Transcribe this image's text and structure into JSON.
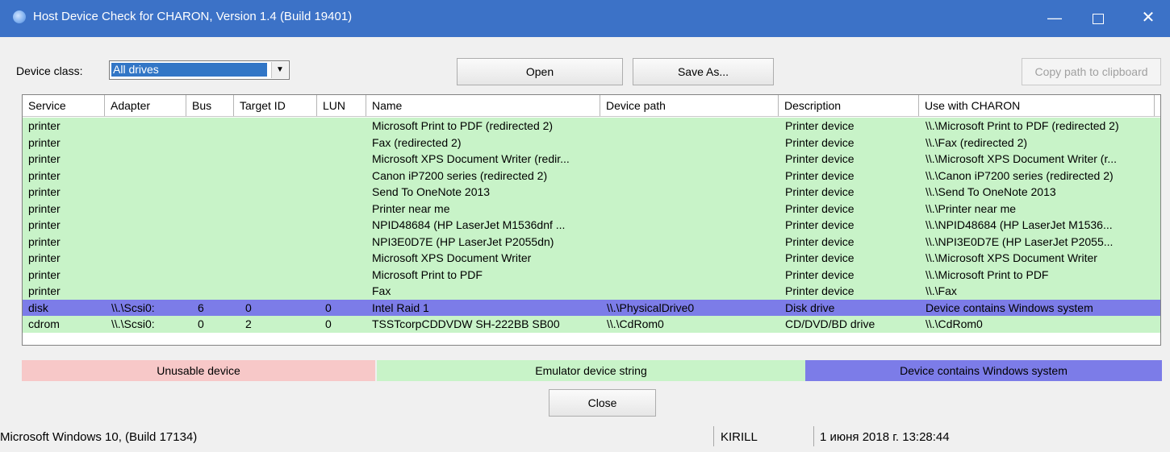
{
  "window": {
    "title": "Host Device Check for CHARON, Version 1.4 (Build 19401)",
    "controls": {
      "minimize": "—",
      "close": "✕"
    }
  },
  "toolbar": {
    "device_class_label": "Device class:",
    "device_class_value": "All drives",
    "open_label": "Open",
    "save_as_label": "Save As...",
    "copy_path_label": "Copy path to clipboard"
  },
  "table": {
    "columns": [
      "Service",
      "Adapter",
      "Bus",
      "Target ID",
      "LUN",
      "Name",
      "Device path",
      "Description",
      "Use with CHARON"
    ],
    "rows": [
      {
        "service": "printer",
        "adapter": "",
        "bus": "",
        "target": "",
        "lun": "",
        "name": "Microsoft Print to PDF (redirected 2)",
        "path": "",
        "description": "Printer device",
        "use": "\\\\.\\Microsoft Print to PDF (redirected 2)",
        "status": "emulator"
      },
      {
        "service": "printer",
        "adapter": "",
        "bus": "",
        "target": "",
        "lun": "",
        "name": "Fax (redirected 2)",
        "path": "",
        "description": "Printer device",
        "use": "\\\\.\\Fax (redirected 2)",
        "status": "emulator"
      },
      {
        "service": "printer",
        "adapter": "",
        "bus": "",
        "target": "",
        "lun": "",
        "name": "Microsoft XPS Document Writer (redir...",
        "path": "",
        "description": "Printer device",
        "use": "\\\\.\\Microsoft XPS Document Writer (r...",
        "status": "emulator"
      },
      {
        "service": "printer",
        "adapter": "",
        "bus": "",
        "target": "",
        "lun": "",
        "name": "Canon iP7200 series (redirected 2)",
        "path": "",
        "description": "Printer device",
        "use": "\\\\.\\Canon iP7200 series (redirected 2)",
        "status": "emulator"
      },
      {
        "service": "printer",
        "adapter": "",
        "bus": "",
        "target": "",
        "lun": "",
        "name": "Send To OneNote 2013",
        "path": "",
        "description": "Printer device",
        "use": "\\\\.\\Send To OneNote 2013",
        "status": "emulator"
      },
      {
        "service": "printer",
        "adapter": "",
        "bus": "",
        "target": "",
        "lun": "",
        "name": "Printer near me",
        "path": "",
        "description": "Printer device",
        "use": "\\\\.\\Printer near me",
        "status": "emulator"
      },
      {
        "service": "printer",
        "adapter": "",
        "bus": "",
        "target": "",
        "lun": "",
        "name": "NPID48684 (HP LaserJet M1536dnf ...",
        "path": "",
        "description": "Printer device",
        "use": "\\\\.\\NPID48684 (HP LaserJet M1536...",
        "status": "emulator"
      },
      {
        "service": "printer",
        "adapter": "",
        "bus": "",
        "target": "",
        "lun": "",
        "name": "NPI3E0D7E (HP LaserJet P2055dn)",
        "path": "",
        "description": "Printer device",
        "use": "\\\\.\\NPI3E0D7E (HP LaserJet P2055...",
        "status": "emulator"
      },
      {
        "service": "printer",
        "adapter": "",
        "bus": "",
        "target": "",
        "lun": "",
        "name": "Microsoft XPS Document Writer",
        "path": "",
        "description": "Printer device",
        "use": "\\\\.\\Microsoft XPS Document Writer",
        "status": "emulator"
      },
      {
        "service": "printer",
        "adapter": "",
        "bus": "",
        "target": "",
        "lun": "",
        "name": "Microsoft Print to PDF",
        "path": "",
        "description": "Printer device",
        "use": "\\\\.\\Microsoft Print to PDF",
        "status": "emulator"
      },
      {
        "service": "printer",
        "adapter": "",
        "bus": "",
        "target": "",
        "lun": "",
        "name": "Fax",
        "path": "",
        "description": "Printer device",
        "use": "\\\\.\\Fax",
        "status": "emulator"
      },
      {
        "service": "disk",
        "adapter": "\\\\.\\Scsi0:",
        "bus": "6",
        "target": "0",
        "lun": "0",
        "name": "Intel Raid 1",
        "path": "\\\\.\\PhysicalDrive0",
        "description": "Disk drive",
        "use": "Device contains Windows system",
        "status": "system"
      },
      {
        "service": "cdrom",
        "adapter": "\\\\.\\Scsi0:",
        "bus": "0",
        "target": "2",
        "lun": "0",
        "name": "TSSTcorpCDDVDW SH-222BB SB00",
        "path": "\\\\.\\CdRom0",
        "description": "CD/DVD/BD drive",
        "use": "\\\\.\\CdRom0",
        "status": "emulator"
      }
    ]
  },
  "legend": {
    "unusable": "Unusable device",
    "emulator": "Emulator device string",
    "system": "Device contains Windows system"
  },
  "colors": {
    "title_bar": "#3c72c7",
    "unusable": "#f7c8c8",
    "emulator": "#c8f3c8",
    "system": "#7c7ce8"
  },
  "close_label": "Close",
  "status_bar": {
    "os": "Microsoft Windows 10,  (Build 17134)",
    "user": "KIRILL",
    "datetime": "1 июня 2018 г. 13:28:44"
  }
}
